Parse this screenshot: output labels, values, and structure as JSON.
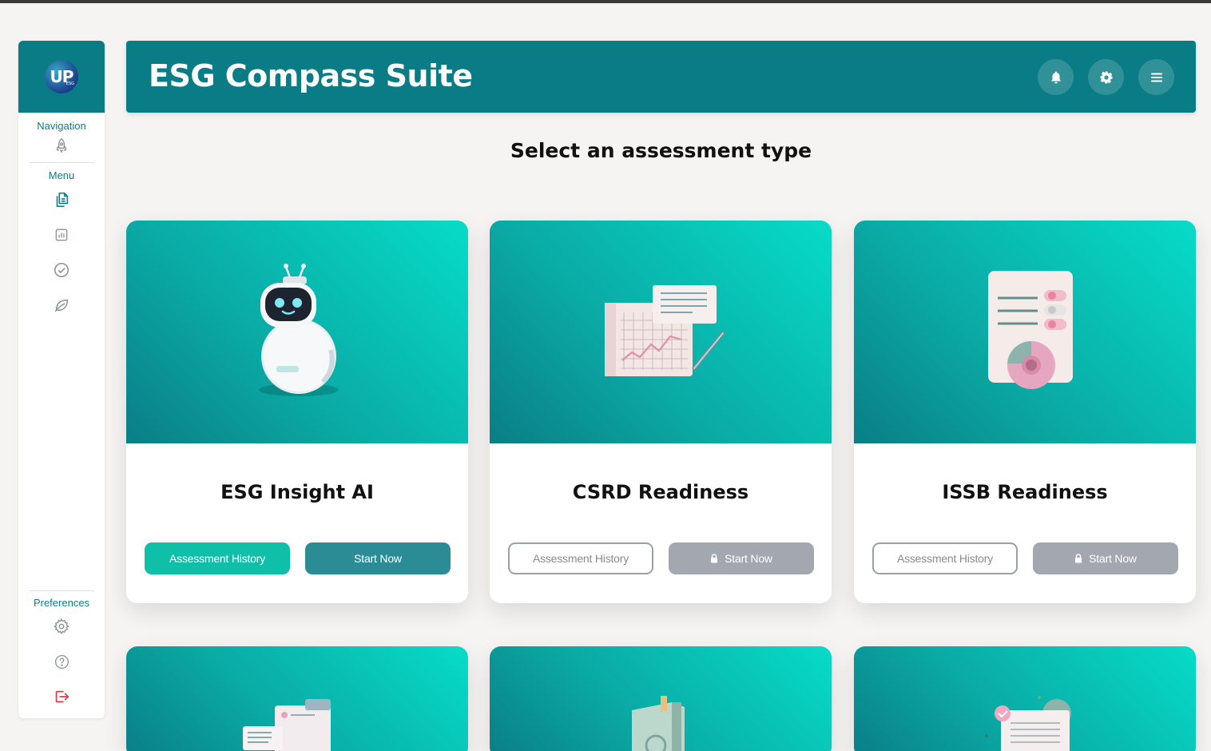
{
  "app": {
    "title": "ESG Compass Suite"
  },
  "logo": {
    "text": "UP",
    "sub": "ESG"
  },
  "sidebar": {
    "navigation_label": "Navigation",
    "menu_label": "Menu",
    "preferences_label": "Preferences",
    "nav_icons": [
      "rocket-icon"
    ],
    "menu_icons": [
      "documents-icon",
      "chart-icon",
      "check-circle-icon",
      "leaf-icon"
    ],
    "preferences_icons": [
      "gear-icon",
      "help-icon",
      "logout-icon"
    ]
  },
  "header": {
    "icons": [
      "bell-icon",
      "gear-icon",
      "hamburger-menu-icon"
    ]
  },
  "main": {
    "title": "Select an assessment type",
    "cards": [
      {
        "title": "ESG Insight AI",
        "history_label": "Assessment History",
        "start_label": "Start Now",
        "locked": false,
        "illustration": "robot"
      },
      {
        "title": "CSRD Readiness",
        "history_label": "Assessment History",
        "start_label": "Start Now",
        "locked": true,
        "illustration": "chart-document"
      },
      {
        "title": "ISSB Readiness",
        "history_label": "Assessment History",
        "start_label": "Start Now",
        "locked": true,
        "illustration": "report-pie"
      }
    ]
  },
  "colors": {
    "primary": "#0a7c86",
    "accent": "#10bfa8",
    "disabled": "#a3a7b0",
    "danger": "#e53950"
  }
}
